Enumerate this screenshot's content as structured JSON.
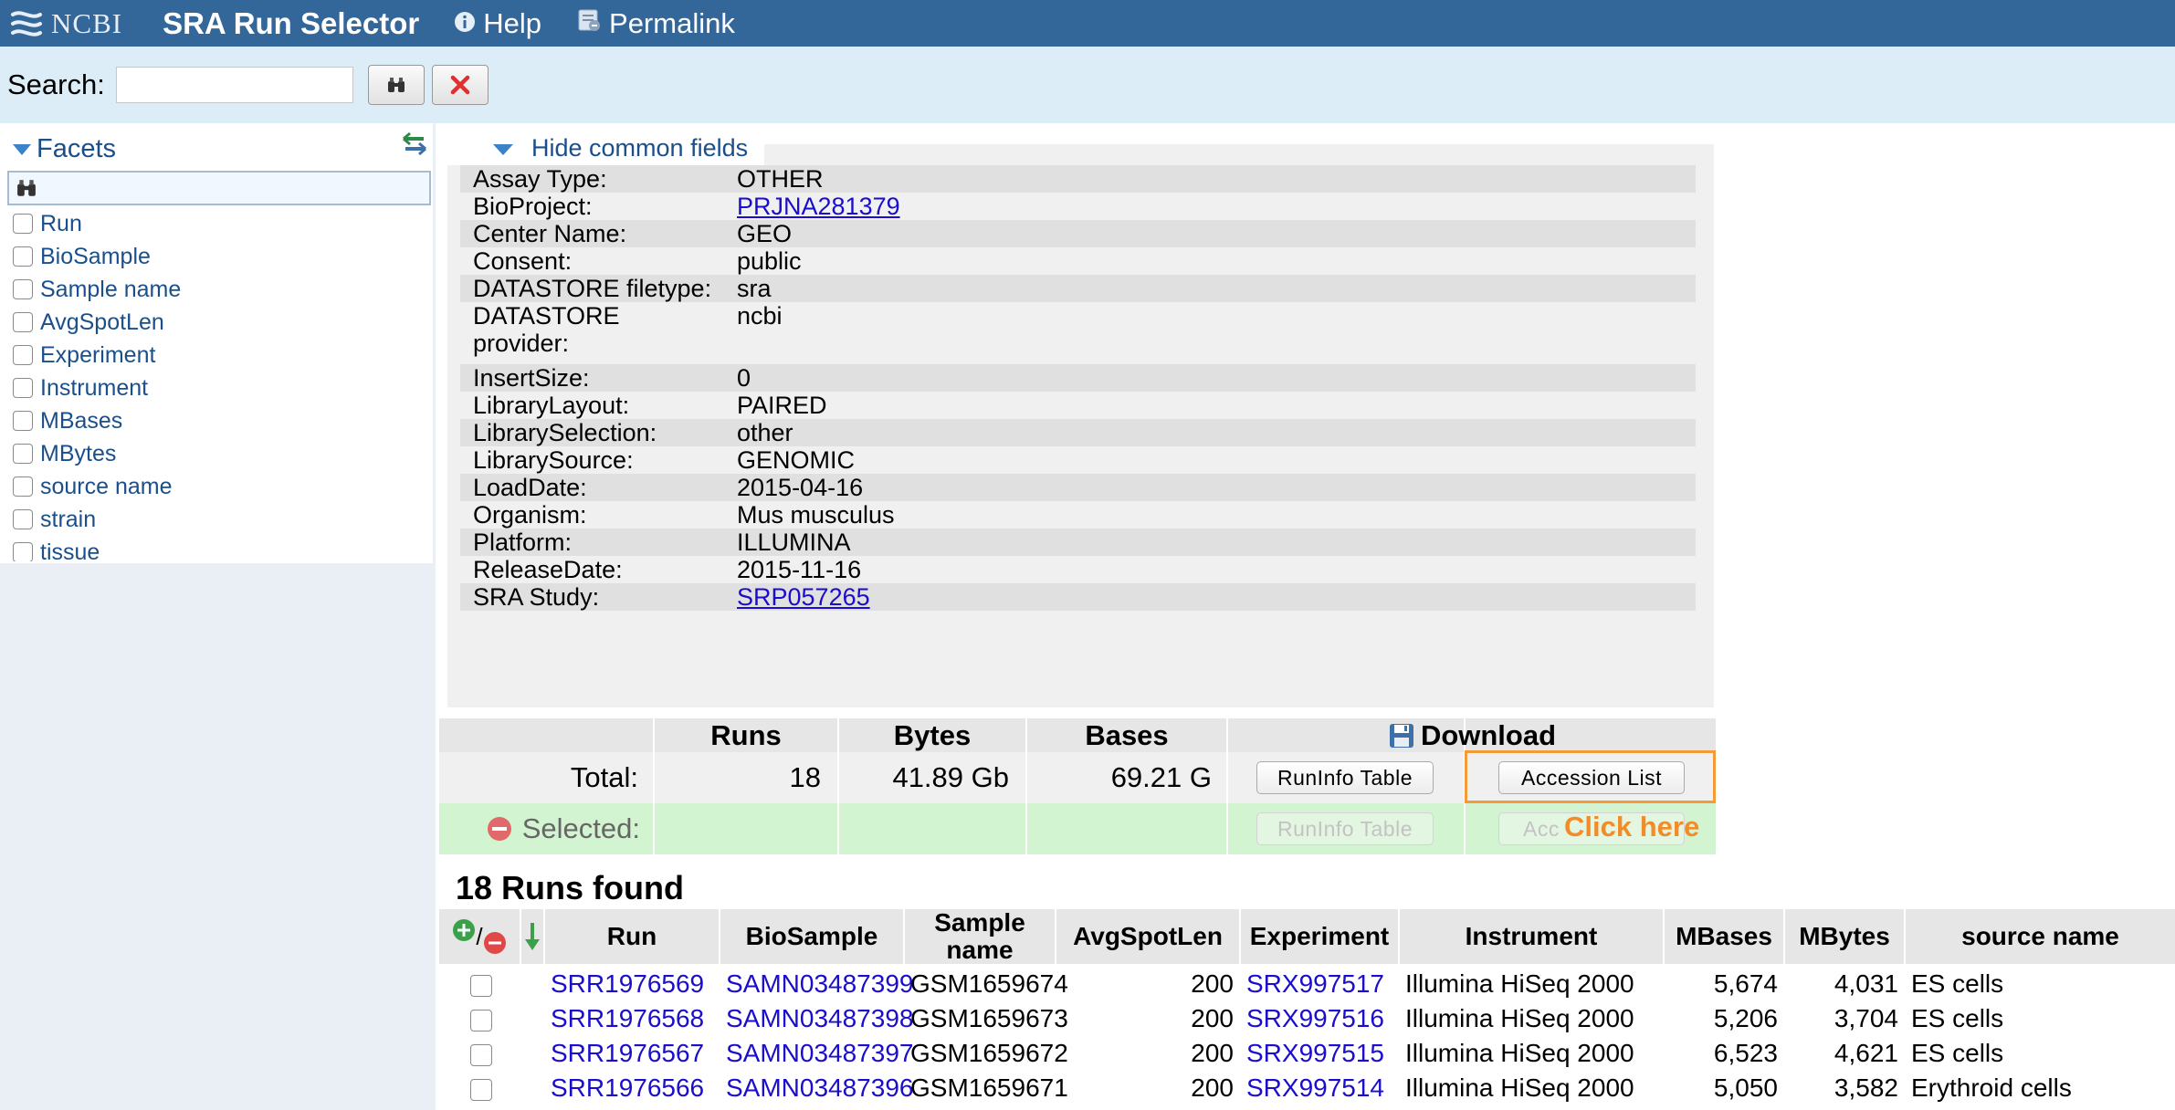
{
  "header": {
    "logo_text": "NCBI",
    "app_title": "SRA Run Selector",
    "help_label": "Help",
    "permalink_label": "Permalink"
  },
  "search": {
    "label": "Search:",
    "value": ""
  },
  "facets": {
    "title": "Facets",
    "items": [
      "Run",
      "BioSample",
      "Sample name",
      "AvgSpotLen",
      "Experiment",
      "Instrument",
      "MBases",
      "MBytes",
      "source name",
      "strain",
      "tissue"
    ]
  },
  "common": {
    "toggle_label": "Hide common fields",
    "fields": [
      {
        "key": "Assay Type:",
        "value": "OTHER"
      },
      {
        "key": "BioProject:",
        "value": "PRJNA281379",
        "link": true
      },
      {
        "key": "Center Name:",
        "value": "GEO"
      },
      {
        "key": "Consent:",
        "value": "public"
      },
      {
        "key": "DATASTORE filetype:",
        "value": "sra"
      },
      {
        "key": "DATASTORE provider:",
        "value": "ncbi",
        "tall": true
      },
      {
        "key": "InsertSize:",
        "value": "0"
      },
      {
        "key": "LibraryLayout:",
        "value": "PAIRED"
      },
      {
        "key": "LibrarySelection:",
        "value": "other"
      },
      {
        "key": "LibrarySource:",
        "value": "GENOMIC"
      },
      {
        "key": "LoadDate:",
        "value": "2015-04-16"
      },
      {
        "key": "Organism:",
        "value": "Mus musculus"
      },
      {
        "key": "Platform:",
        "value": "ILLUMINA"
      },
      {
        "key": "ReleaseDate:",
        "value": "2015-11-16"
      },
      {
        "key": "SRA Study:",
        "value": "SRP057265",
        "link": true
      }
    ]
  },
  "summary": {
    "col_runs": "Runs",
    "col_bytes": "Bytes",
    "col_bases": "Bases",
    "col_download": "Download",
    "total_label": "Total:",
    "total_runs": "18",
    "total_bytes": "41.89 Gb",
    "total_bases": "69.21 G",
    "selected_label": "Selected:",
    "runinfo_label": "RunInfo Table",
    "accession_label": "Accession List",
    "accession_disabled_label": "Acc",
    "callout": "Click here"
  },
  "runs": {
    "title": "18 Runs found",
    "headers": [
      "Run",
      "BioSample",
      "Sample name",
      "AvgSpotLen",
      "Experiment",
      "Instrument",
      "MBases",
      "MBytes",
      "source name"
    ],
    "rows": [
      [
        "SRR1976569",
        "SAMN03487399",
        "GSM1659674",
        "200",
        "SRX997517",
        "Illumina HiSeq 2000",
        "5,674",
        "4,031",
        "ES cells"
      ],
      [
        "SRR1976568",
        "SAMN03487398",
        "GSM1659673",
        "200",
        "SRX997516",
        "Illumina HiSeq 2000",
        "5,206",
        "3,704",
        "ES cells"
      ],
      [
        "SRR1976567",
        "SAMN03487397",
        "GSM1659672",
        "200",
        "SRX997515",
        "Illumina HiSeq 2000",
        "6,523",
        "4,621",
        "ES cells"
      ],
      [
        "SRR1976566",
        "SAMN03487396",
        "GSM1659671",
        "200",
        "SRX997514",
        "Illumina HiSeq 2000",
        "5,050",
        "3,582",
        "Erythroid cells"
      ]
    ]
  }
}
